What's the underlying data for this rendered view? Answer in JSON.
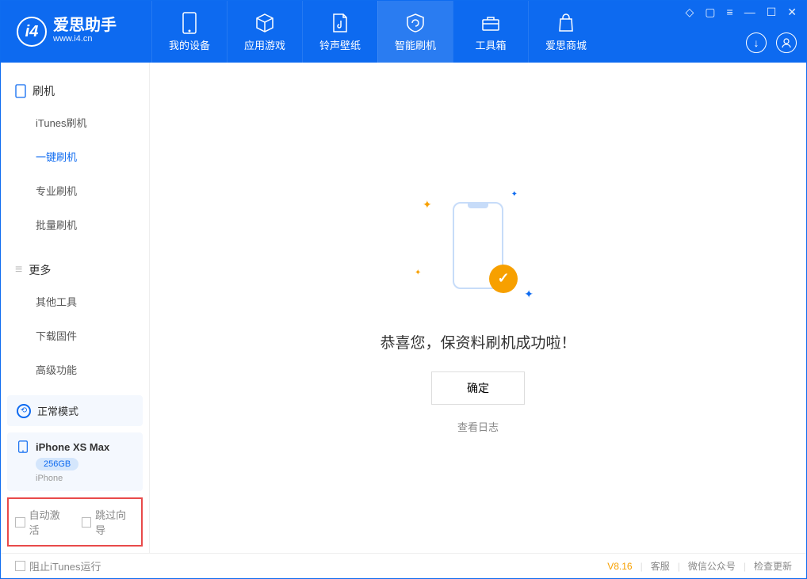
{
  "app": {
    "name": "爱思助手",
    "url": "www.i4.cn"
  },
  "tabs": [
    {
      "label": "我的设备"
    },
    {
      "label": "应用游戏"
    },
    {
      "label": "铃声壁纸"
    },
    {
      "label": "智能刷机"
    },
    {
      "label": "工具箱"
    },
    {
      "label": "爱思商城"
    }
  ],
  "sidebar": {
    "section1": {
      "title": "刷机",
      "items": [
        "iTunes刷机",
        "一键刷机",
        "专业刷机",
        "批量刷机"
      ]
    },
    "section2": {
      "title": "更多",
      "items": [
        "其他工具",
        "下载固件",
        "高级功能"
      ]
    },
    "mode": "正常模式",
    "device": {
      "name": "iPhone XS Max",
      "storage": "256GB",
      "type": "iPhone"
    },
    "opt_auto_activate": "自动激活",
    "opt_skip_guide": "跳过向导"
  },
  "main": {
    "success_msg": "恭喜您，保资料刷机成功啦！",
    "confirm": "确定",
    "view_log": "查看日志"
  },
  "footer": {
    "block_itunes": "阻止iTunes运行",
    "version": "V8.16",
    "links": [
      "客服",
      "微信公众号",
      "检查更新"
    ]
  }
}
